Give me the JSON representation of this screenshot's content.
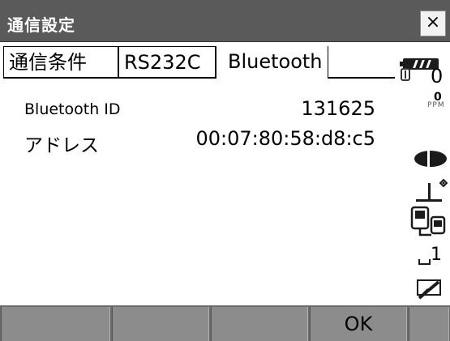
{
  "window": {
    "title": "通信設定",
    "close_glyph": "×"
  },
  "tabs": [
    {
      "label": "通信条件",
      "active": false
    },
    {
      "label": "RS232C",
      "active": false
    },
    {
      "label": "Bluetooth",
      "active": true
    }
  ],
  "bluetooth": {
    "id_label": "Bluetooth ID",
    "id_value": "131625",
    "address_label": "アドレス",
    "address_value": "00:07:80:58:d8:c5"
  },
  "status": {
    "ppm_big": "0",
    "ppm_small": "0",
    "ppm_unit": "PPM",
    "mode_value": "1"
  },
  "softkeys": [
    "",
    "",
    "",
    "OK",
    ""
  ]
}
